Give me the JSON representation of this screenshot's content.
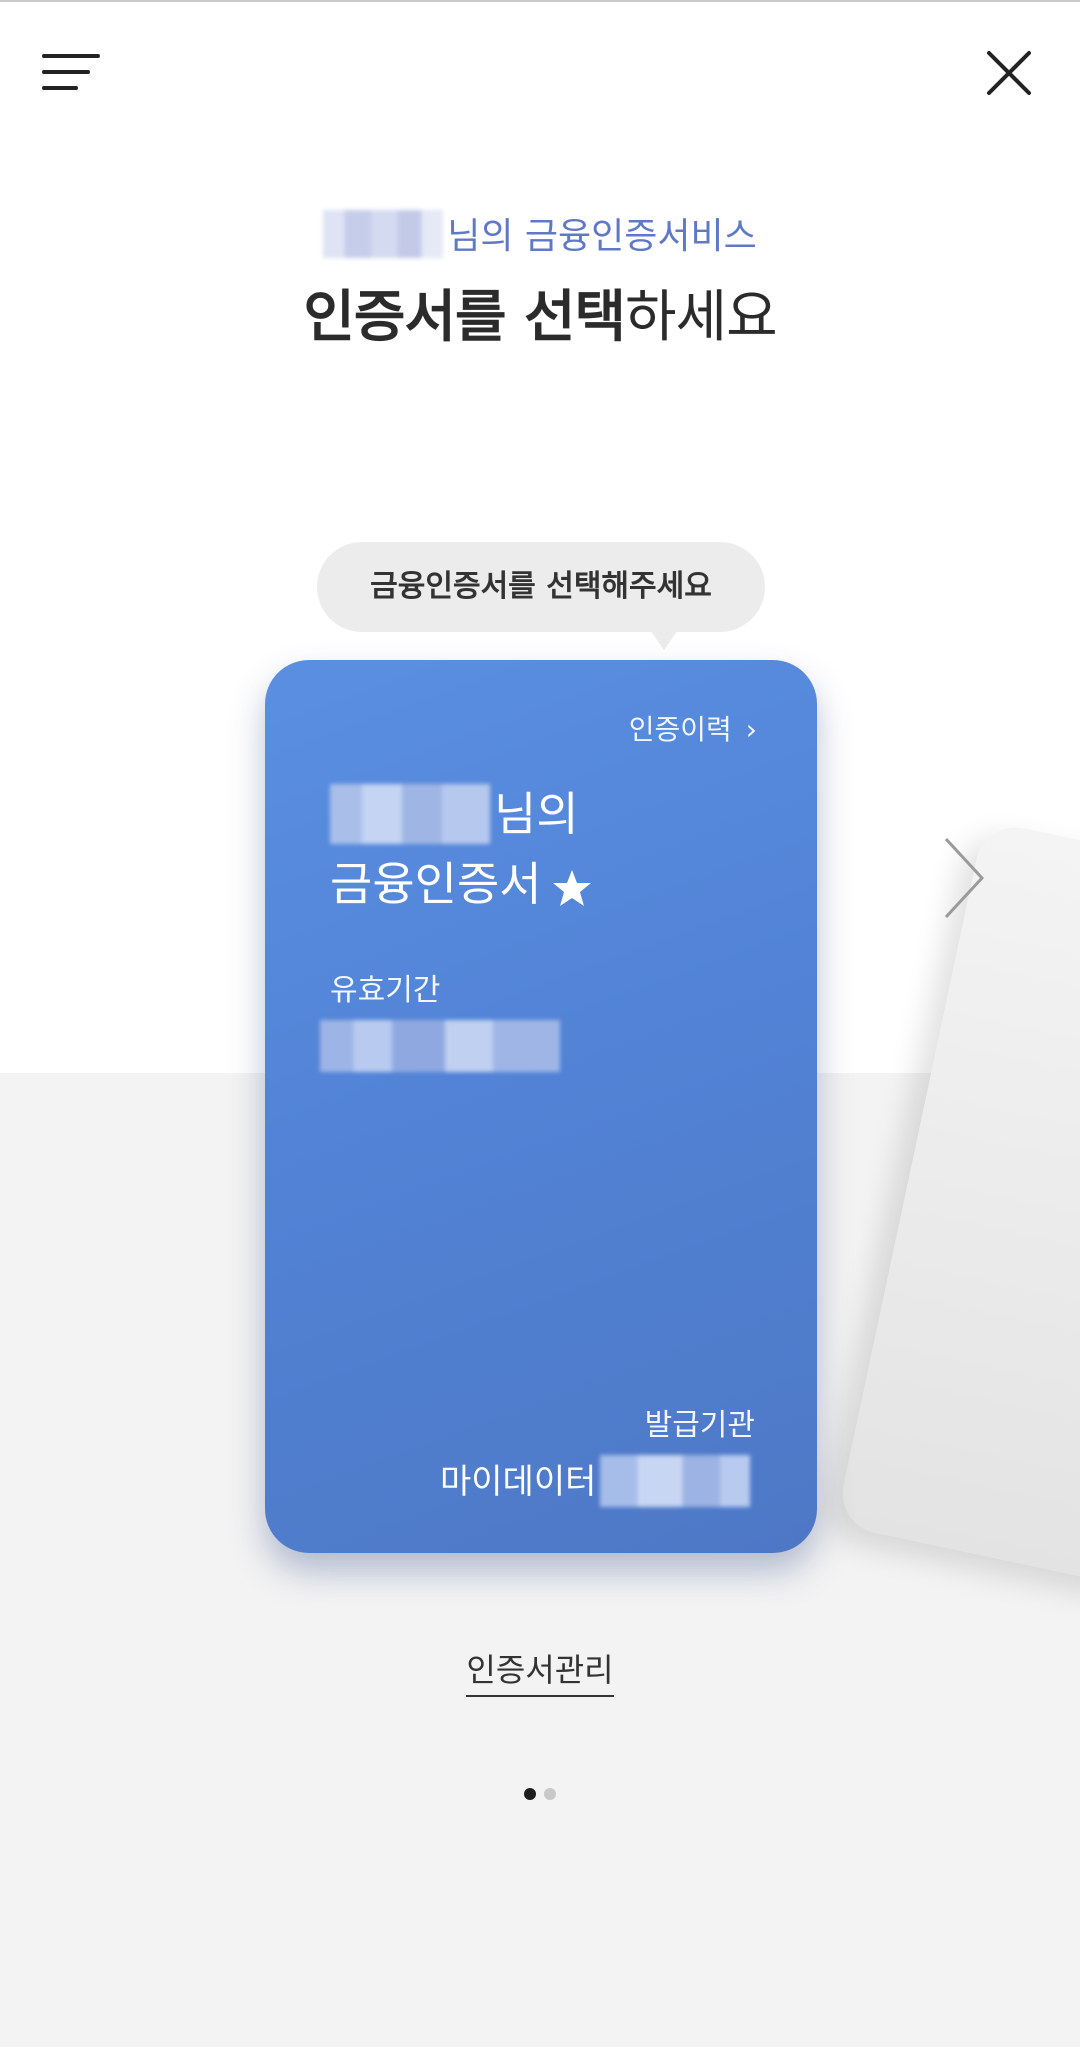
{
  "header": {
    "menu_icon": "menu-lines-icon",
    "close_icon": "close-icon"
  },
  "greeting": {
    "suffix": "님의 금융인증서비스"
  },
  "title": {
    "strong_part": "인증서를 선택",
    "normal_part": "하세요"
  },
  "tooltip": {
    "text": "금융인증서를 선택해주세요"
  },
  "card": {
    "history_label": "인증이력",
    "history_chevron": "›",
    "name_suffix": "님의",
    "title": "금융인증서",
    "star_icon": "star-icon",
    "validity_label": "유효기간",
    "issuer_label": "발급기관",
    "issuer_value": "마이데이터",
    "colors": {
      "gradient_start": "#5a8fe1",
      "gradient_end": "#4e78c6"
    }
  },
  "next_arrow_icon": "chevron-right-icon",
  "manage_link": {
    "label": "인증서관리"
  },
  "pagination": {
    "current": 1,
    "total": 2
  },
  "colors": {
    "accent_text": "#5f79c6",
    "lower_background": "#f3f3f3"
  }
}
